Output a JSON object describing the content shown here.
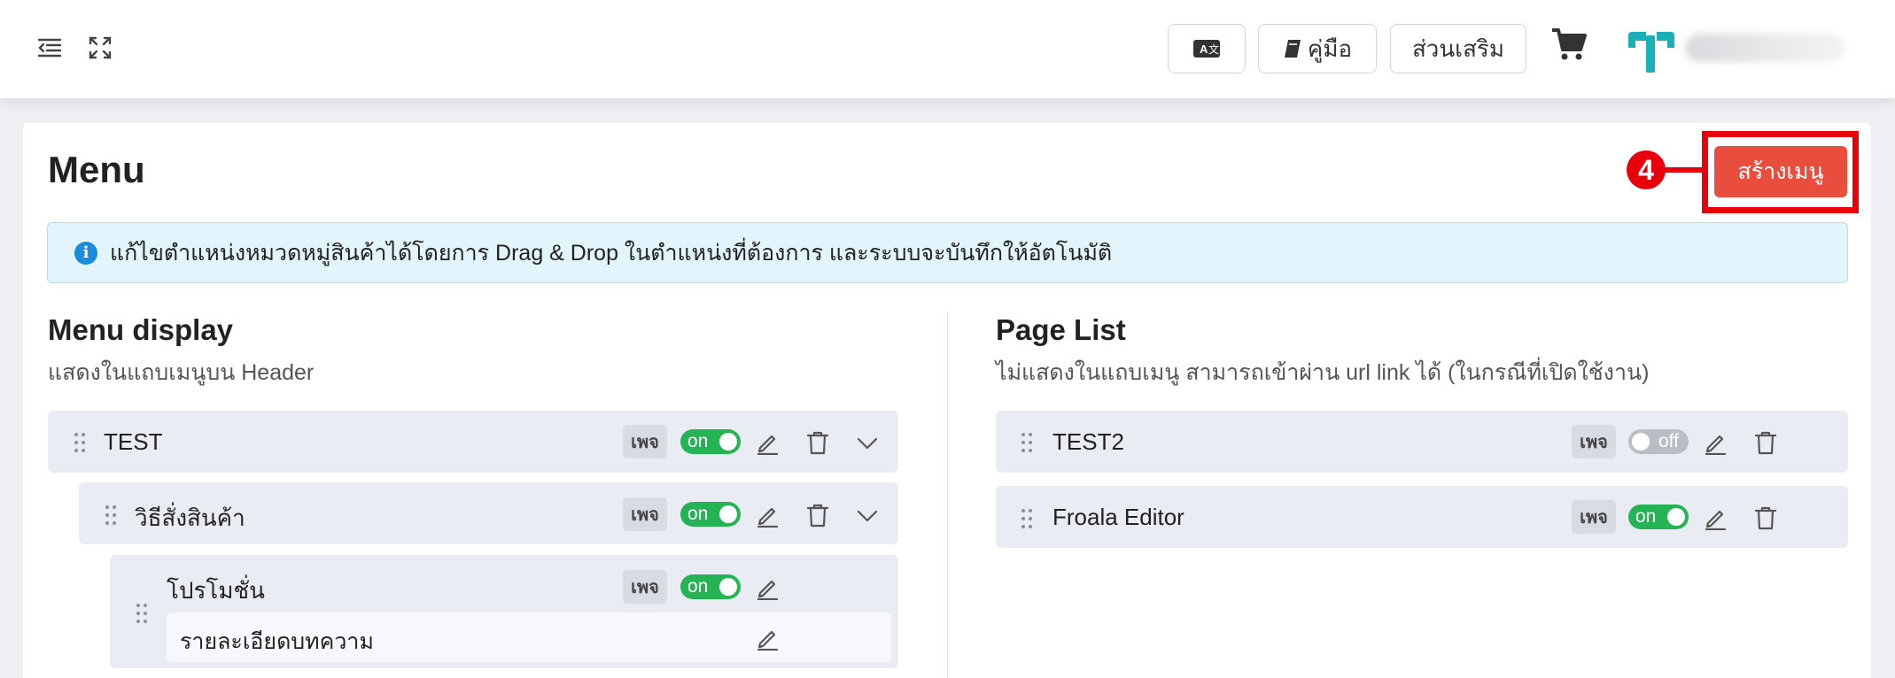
{
  "topbar": {
    "translate_icon": "translate-icon",
    "manual_label": "คู่มือ",
    "addons_label": "ส่วนเสริม",
    "cart_icon": "cart-icon"
  },
  "page": {
    "title": "Menu",
    "create_button": "สร้างเมนู",
    "annotation_number": "4"
  },
  "alert": {
    "text": "แก้ไขตำแหน่งหมวดหมู่สินค้าได้โดยการ Drag & Drop ในตำแหน่งที่ต้องการ และระบบจะบันทึกให้อัตโนมัติ"
  },
  "menu_display": {
    "title": "Menu display",
    "subtitle": "แสดงในแถบเมนูบน Header",
    "items": [
      {
        "label": "TEST",
        "badge": "เพจ",
        "toggle": "on"
      },
      {
        "label": "วิธีสั่งสินค้า",
        "badge": "เพจ",
        "toggle": "on"
      },
      {
        "label": "โปรโมชั่น",
        "badge": "เพจ",
        "toggle": "on",
        "child": "รายละเอียดบทความ"
      }
    ]
  },
  "page_list": {
    "title": "Page List",
    "subtitle": "ไม่แสดงในแถบเมนู สามารถเข้าผ่าน url link ได้ (ในกรณีที่เปิดใช้งาน)",
    "items": [
      {
        "label": "TEST2",
        "badge": "เพจ",
        "toggle": "off"
      },
      {
        "label": "Froala Editor",
        "badge": "เพจ",
        "toggle": "on"
      }
    ]
  },
  "colors": {
    "accent": "#e84d3d",
    "annotation": "#e8000b",
    "toggle_on": "#25b356",
    "toggle_off": "#b9bdc4"
  }
}
